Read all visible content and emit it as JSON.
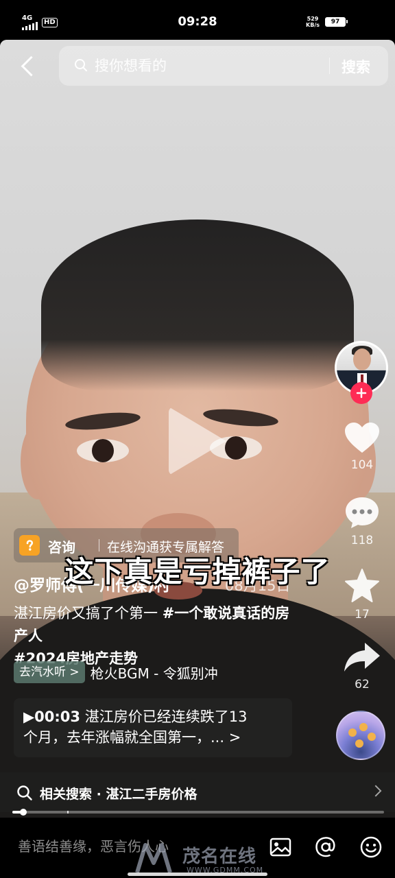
{
  "status_bar": {
    "network": "4G",
    "hd": "HD",
    "time": "09:28",
    "speed_value": "529",
    "speed_unit": "KB/s",
    "battery": "97"
  },
  "search": {
    "placeholder": "搜你想看的",
    "button_label": "搜索"
  },
  "video": {
    "caption_overlay": "这下真是亏掉裤子了",
    "progress": 0.03
  },
  "sidebar": {
    "likes": "104",
    "comments": "118",
    "favorites": "17",
    "shares": "62"
  },
  "consult": {
    "label": "咨询",
    "description": "在线沟通获专属解答"
  },
  "post": {
    "author": "@罗师傅(一川传媒)村",
    "date": "08月15日",
    "desc_text": "湛江房价又搞了个第一 ",
    "tag1": "#一个敢说真话的房产人",
    "tag2": "#2024房地产走势"
  },
  "music": {
    "badge": "去汽水听",
    "name": "枪火BGM - 令狐别冲"
  },
  "summary": {
    "time": "00:03",
    "line1": "湛江房价已经连续跌了13",
    "line2": "个月，去年涨幅就全国第一，..."
  },
  "related": {
    "text": "相关搜索 · 湛江二手房价格"
  },
  "comment_bar": {
    "placeholder": "善语结善缘，恶言伤人心"
  },
  "watermark": {
    "name": "茂名在线",
    "url": "WWW.GDMM.COM"
  },
  "colors": {
    "accent": "#fe2c55",
    "consult_icon": "#f7a325"
  }
}
